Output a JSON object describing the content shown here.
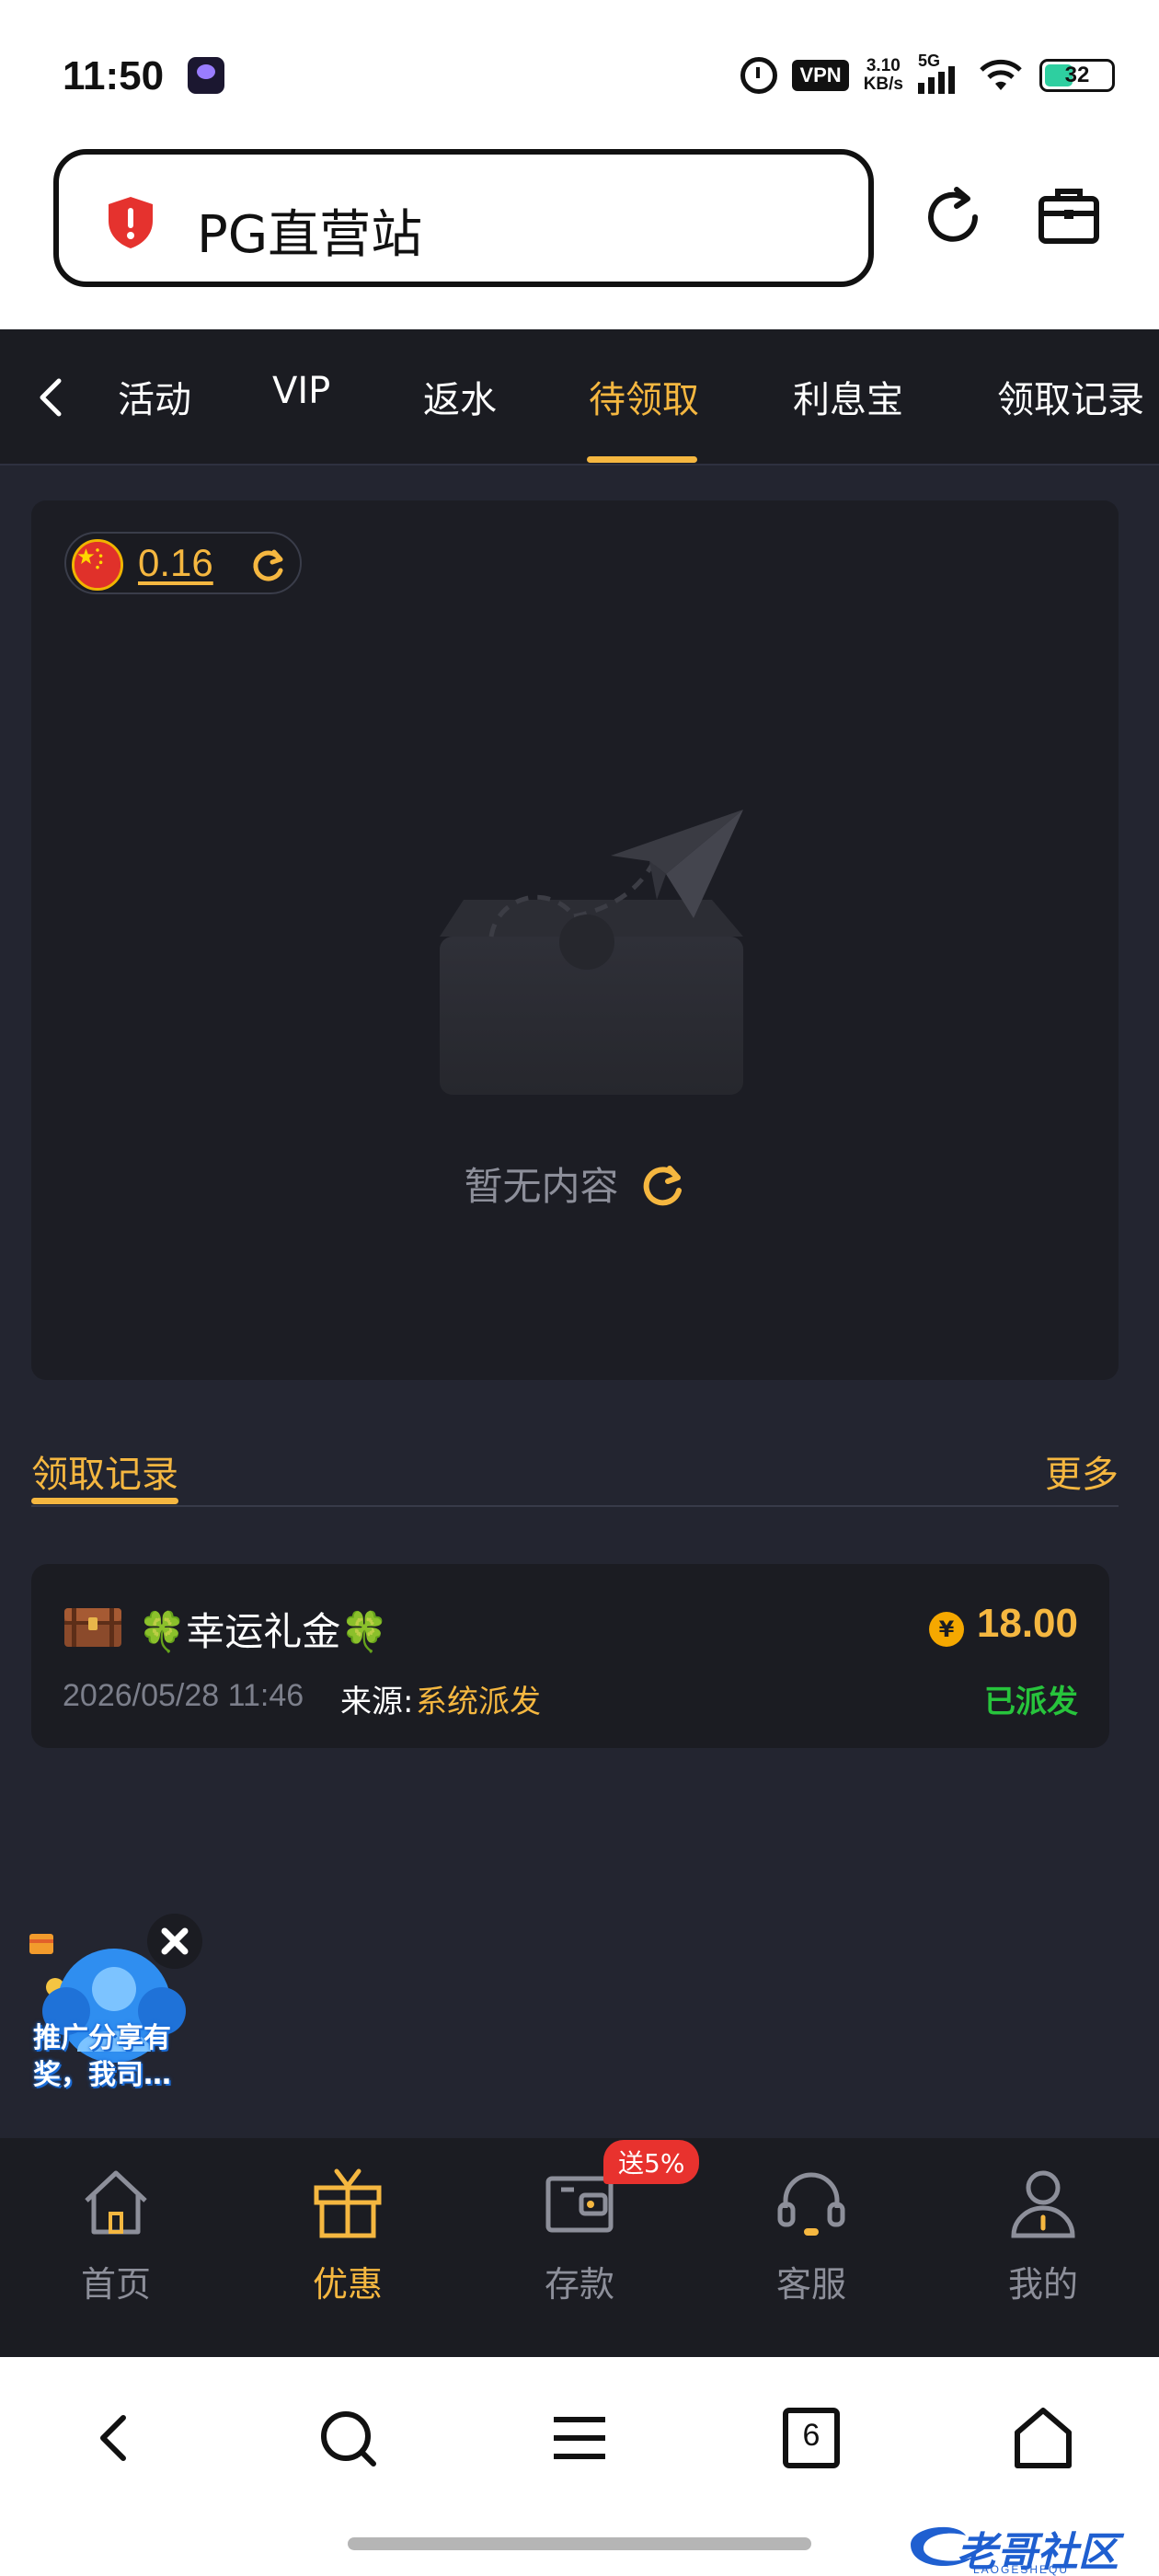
{
  "status_bar": {
    "time": "11:50",
    "vpn": "VPN",
    "speed_value": "3.10",
    "speed_unit": "KB/s",
    "network": "5G",
    "battery": "32"
  },
  "browser": {
    "url_title": "PG直营站",
    "reload_icon": "reload-icon",
    "tools_icon": "briefcase-icon"
  },
  "tabs": [
    {
      "label": "活动"
    },
    {
      "label": "VIP"
    },
    {
      "label": "返水"
    },
    {
      "label": "待领取",
      "active": true
    },
    {
      "label": "利息宝"
    },
    {
      "label": "领取记录"
    }
  ],
  "balance": {
    "value": "0.16"
  },
  "empty_state": {
    "text": "暂无内容"
  },
  "records": {
    "title": "领取记录",
    "more": "更多",
    "items": [
      {
        "title": "🍀幸运礼金🍀",
        "amount": "18.00",
        "currency_symbol": "¥",
        "date": "2026/05/28 11:46",
        "source_label": "来源:",
        "source_value": "系统派发",
        "status": "已派发"
      }
    ]
  },
  "promo": {
    "text_line1": "推广分享有",
    "text_line2": "奖，我司…"
  },
  "app_nav": {
    "items": [
      {
        "label": "首页",
        "icon": "home-icon"
      },
      {
        "label": "优惠",
        "icon": "gift-icon",
        "active": true
      },
      {
        "label": "存款",
        "icon": "wallet-icon"
      },
      {
        "label": "客服",
        "icon": "headset-icon"
      },
      {
        "label": "我的",
        "icon": "user-icon"
      }
    ],
    "deposit_badge": "送5%"
  },
  "system_nav": {
    "tab_count": "6"
  },
  "watermark": {
    "text": "老哥社区",
    "sub": "LAOGESHEQU"
  },
  "colors": {
    "accent": "#f5b740",
    "background": "#232530",
    "card": "#1b1c22",
    "success": "#27c43c",
    "badge": "#e8322e"
  }
}
